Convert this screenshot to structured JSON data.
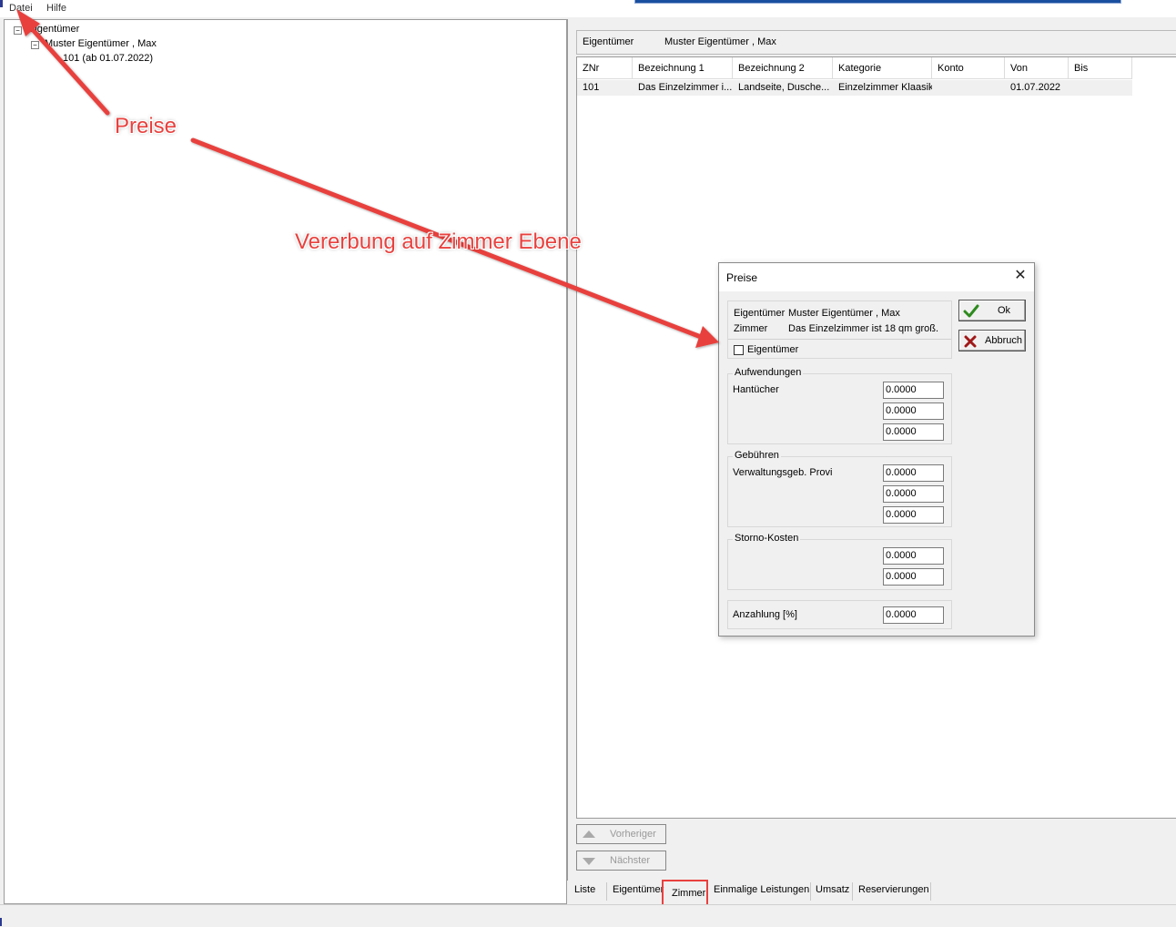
{
  "menu": {
    "items": [
      "Datei",
      "Hilfe"
    ]
  },
  "tree": {
    "root": "Eigentümer",
    "owner": "Muster Eigentümer , Max",
    "room": "101 (ab 01.07.2022)"
  },
  "info_bar": {
    "label": "Eigentümer",
    "value": "Muster Eigentümer , Max"
  },
  "grid": {
    "columns": [
      "ZNr",
      "Bezeichnung 1",
      "Bezeichnung 2",
      "Kategorie",
      "Konto",
      "Von",
      "Bis"
    ],
    "rows": [
      [
        "101",
        "Das Einzelzimmer i...",
        "Landseite, Dusche...",
        "Einzelzimmer Klaasik",
        "",
        "01.07.2022",
        ""
      ]
    ]
  },
  "nav": {
    "prev_label": "Vorheriger",
    "next_label": "Nächster"
  },
  "tabs": [
    "Liste",
    "Eigentümer",
    "Zimmer",
    "Einmalige Leistungen",
    "Umsatz",
    "Reservierungen"
  ],
  "dialog": {
    "title": "Preise",
    "close_glyph": "✕",
    "owner_label": "Eigentümer",
    "owner_value": "Muster Eigentümer , Max",
    "room_label": "Zimmer",
    "room_value": "Das Einzelzimmer ist 18 qm groß.",
    "checkbox_label": "Eigentümer",
    "ok_label": "Ok",
    "cancel_label": "Abbruch",
    "groups": {
      "aufwendungen": {
        "title": "Aufwendungen",
        "item_label": "Hantücher",
        "values": [
          "0.0000",
          "0.0000",
          "0.0000"
        ]
      },
      "gebuehren": {
        "title": "Gebühren",
        "item_label": "Verwaltungsgeb. Provi",
        "values": [
          "0.0000",
          "0.0000",
          "0.0000"
        ]
      },
      "storno": {
        "title": "Storno-Kosten",
        "values": [
          "0.0000",
          "0.0000"
        ]
      },
      "anzahlung": {
        "label": "Anzahlung [%]",
        "value": "0.0000"
      }
    }
  },
  "annotations": {
    "preise": "Preise",
    "vererbung": "Vererbung auf Zimmer Ebene"
  },
  "colors": {
    "annotation": "#e8413e",
    "ok_check": "#2e8b1e",
    "cancel_x": "#a01818"
  }
}
